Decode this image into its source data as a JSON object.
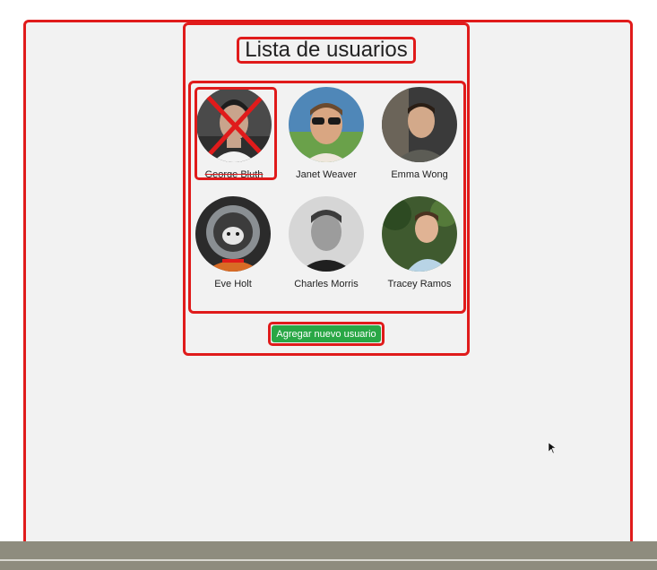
{
  "header": {
    "title": "Lista de usuarios"
  },
  "users": [
    {
      "name": "George Bluth",
      "removed": true
    },
    {
      "name": "Janet Weaver",
      "removed": false
    },
    {
      "name": "Emma Wong",
      "removed": false
    },
    {
      "name": "Eve Holt",
      "removed": false
    },
    {
      "name": "Charles Morris",
      "removed": false
    },
    {
      "name": "Tracey Ramos",
      "removed": false
    }
  ],
  "actions": {
    "add_user_label": "Agregar nuevo usuario"
  },
  "colors": {
    "highlight": "#e01b1b",
    "button": "#29a745",
    "background": "#f2f2f2"
  }
}
